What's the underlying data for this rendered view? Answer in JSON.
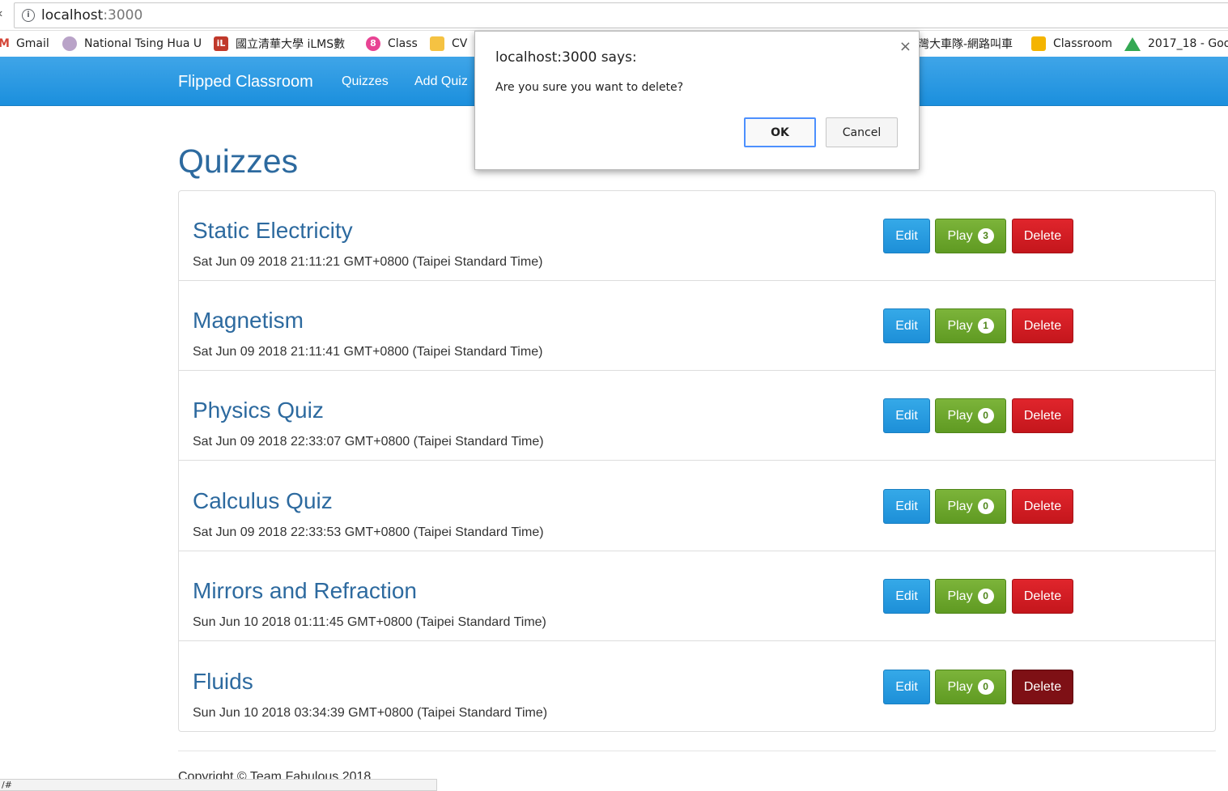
{
  "browser": {
    "url_host": "localhost",
    "url_port": ":3000",
    "bookmarks": [
      {
        "label": "Gmail",
        "icon": "gmail-icon"
      },
      {
        "label": "National Tsing Hua U",
        "icon": "nthu-icon"
      },
      {
        "label": "國立清華大學 iLMS數",
        "icon": "ilms-icon"
      },
      {
        "label": "Class",
        "icon": "class-icon"
      },
      {
        "label": "CV",
        "icon": "folder-icon"
      },
      {
        "label": "灣大車隊-網路叫車",
        "icon": ""
      },
      {
        "label": "Classroom",
        "icon": "classroom-icon"
      },
      {
        "label": "2017_18 - Goo",
        "icon": "drive-icon"
      }
    ]
  },
  "navbar": {
    "brand": "Flipped Classroom",
    "links": [
      "Quizzes",
      "Add Quiz"
    ]
  },
  "page": {
    "title": "Quizzes"
  },
  "buttons": {
    "edit": "Edit",
    "play": "Play",
    "delete": "Delete"
  },
  "quizzes": [
    {
      "title": "Static Electricity",
      "date": "Sat Jun 09 2018 21:11:21 GMT+0800 (Taipei Standard Time)",
      "plays": "3"
    },
    {
      "title": "Magnetism",
      "date": "Sat Jun 09 2018 21:11:41 GMT+0800 (Taipei Standard Time)",
      "plays": "1"
    },
    {
      "title": "Physics Quiz",
      "date": "Sat Jun 09 2018 22:33:07 GMT+0800 (Taipei Standard Time)",
      "plays": "0"
    },
    {
      "title": "Calculus Quiz",
      "date": "Sat Jun 09 2018 22:33:53 GMT+0800 (Taipei Standard Time)",
      "plays": "0"
    },
    {
      "title": "Mirrors and Refraction",
      "date": "Sun Jun 10 2018 01:11:45 GMT+0800 (Taipei Standard Time)",
      "plays": "0"
    },
    {
      "title": "Fluids",
      "date": "Sun Jun 10 2018 03:34:39 GMT+0800 (Taipei Standard Time)",
      "plays": "0"
    }
  ],
  "footer": {
    "text": "Copyright © Team Fabulous 2018",
    "status_url": "/#"
  },
  "dialog": {
    "title": "localhost:3000 says:",
    "message": "Are you sure you want to delete?",
    "ok": "OK",
    "cancel": "Cancel",
    "close": "×"
  },
  "colors": {
    "navbar": "#1b8fdd",
    "title": "#2d6a9f",
    "edit": "#1d8fd8",
    "play": "#5f9a22",
    "delete": "#c4161c",
    "delete_active": "#7e1015"
  }
}
